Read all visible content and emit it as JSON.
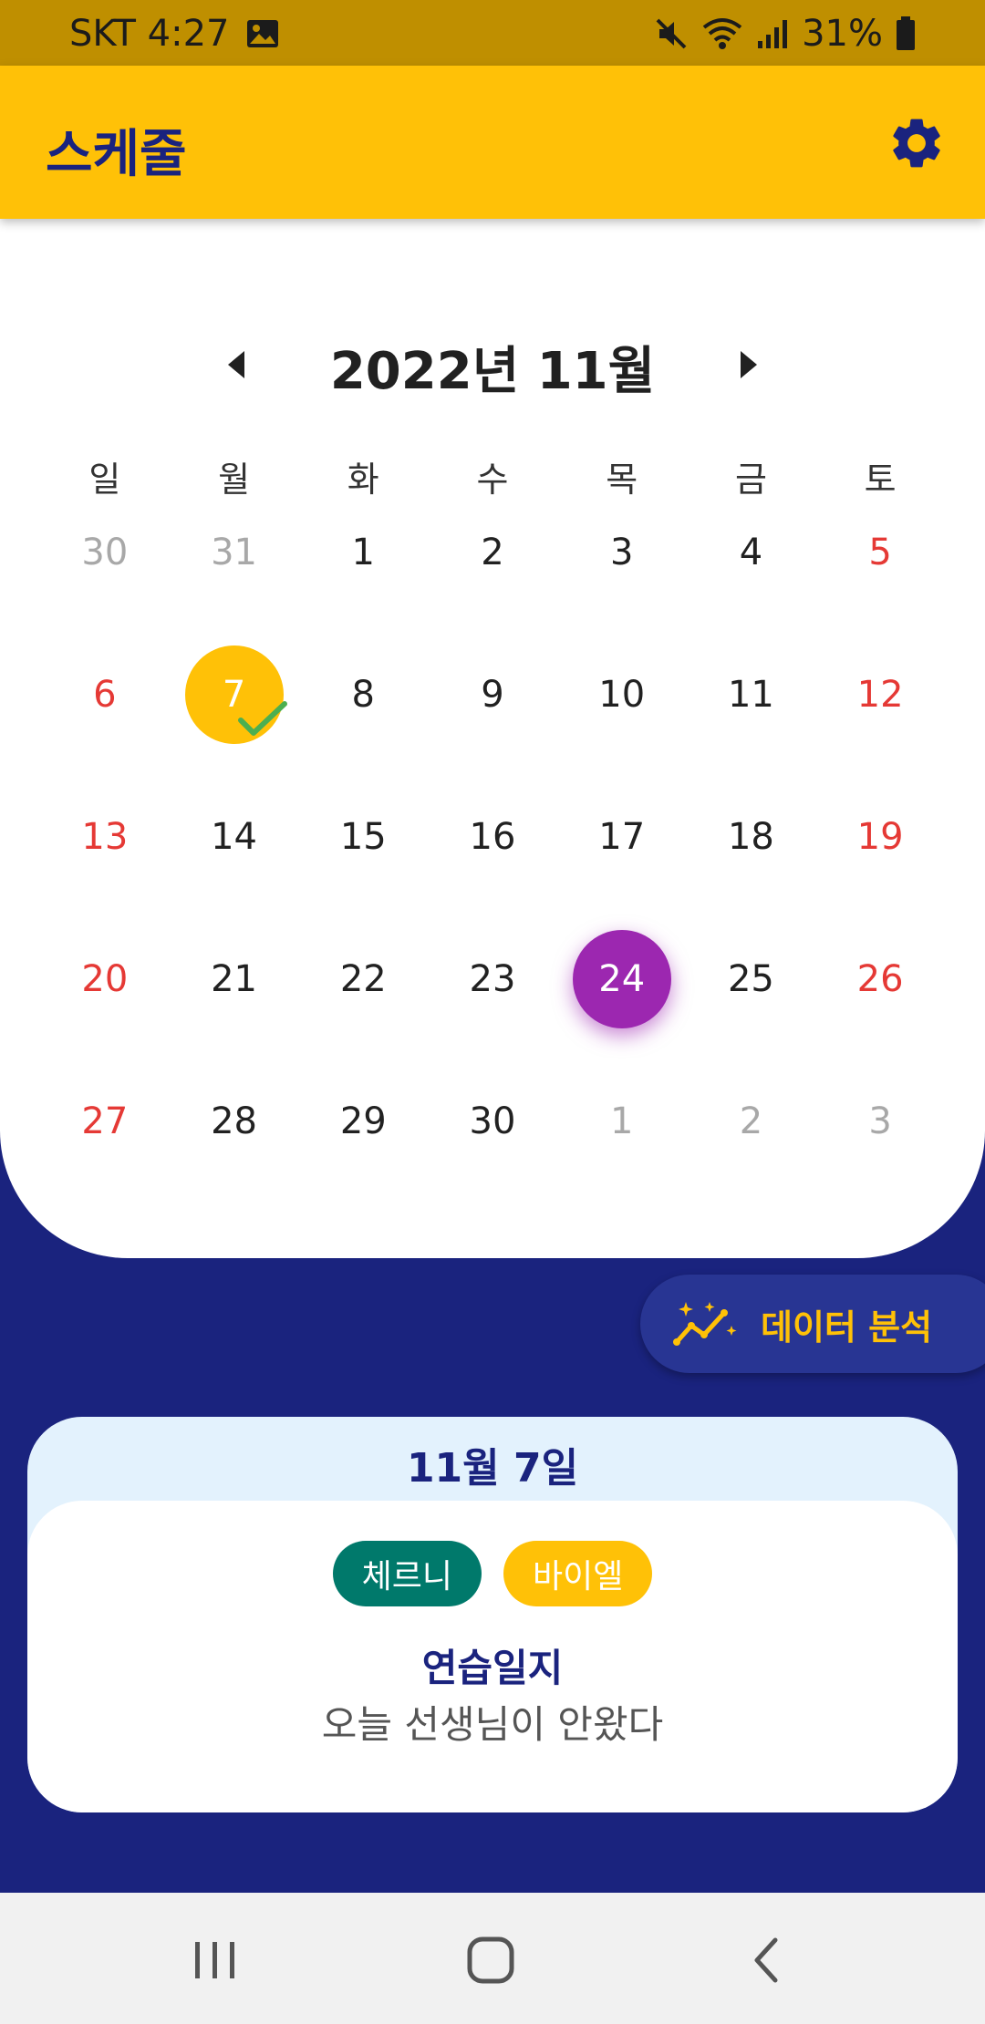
{
  "status_bar": {
    "carrier_time": "SKT 4:27",
    "battery": "31%",
    "icons": [
      "image-icon",
      "mute-icon",
      "wifi-icon",
      "signal-icon",
      "battery-icon"
    ]
  },
  "app_bar": {
    "title": "스케줄",
    "settings_icon": "gear-icon"
  },
  "calendar": {
    "month_title": "2022년 11월",
    "weekdays": [
      "일",
      "월",
      "화",
      "수",
      "목",
      "금",
      "토"
    ],
    "days": [
      {
        "label": "30",
        "other": true,
        "holiday": true
      },
      {
        "label": "31",
        "other": true
      },
      {
        "label": "1"
      },
      {
        "label": "2"
      },
      {
        "label": "3"
      },
      {
        "label": "4"
      },
      {
        "label": "5",
        "holiday": true
      },
      {
        "label": "6",
        "holiday": true
      },
      {
        "label": "7",
        "marked": true,
        "checked": true
      },
      {
        "label": "8"
      },
      {
        "label": "9"
      },
      {
        "label": "10"
      },
      {
        "label": "11"
      },
      {
        "label": "12",
        "holiday": true
      },
      {
        "label": "13",
        "holiday": true
      },
      {
        "label": "14"
      },
      {
        "label": "15"
      },
      {
        "label": "16"
      },
      {
        "label": "17"
      },
      {
        "label": "18"
      },
      {
        "label": "19",
        "holiday": true
      },
      {
        "label": "20",
        "holiday": true
      },
      {
        "label": "21"
      },
      {
        "label": "22"
      },
      {
        "label": "23"
      },
      {
        "label": "24",
        "today": true
      },
      {
        "label": "25"
      },
      {
        "label": "26",
        "holiday": true
      },
      {
        "label": "27",
        "holiday": true
      },
      {
        "label": "28"
      },
      {
        "label": "29"
      },
      {
        "label": "30"
      },
      {
        "label": "1",
        "other": true
      },
      {
        "label": "2",
        "other": true
      },
      {
        "label": "3",
        "other": true,
        "holiday": true
      }
    ]
  },
  "analysis_button": {
    "label": "데이터 분석",
    "icon": "sparkle-chart-icon"
  },
  "entry": {
    "date": "11월 7일",
    "tags": [
      {
        "label": "체르니",
        "color": "#00796b"
      },
      {
        "label": "바이엘",
        "color": "#ffc107"
      }
    ],
    "heading": "연습일지",
    "text": "오늘 선생님이 안왔다"
  },
  "colors": {
    "accent": "#ffc107",
    "primary": "#1a237e",
    "today": "#9c27b0",
    "holiday": "#e53935",
    "check": "#4caf50"
  }
}
